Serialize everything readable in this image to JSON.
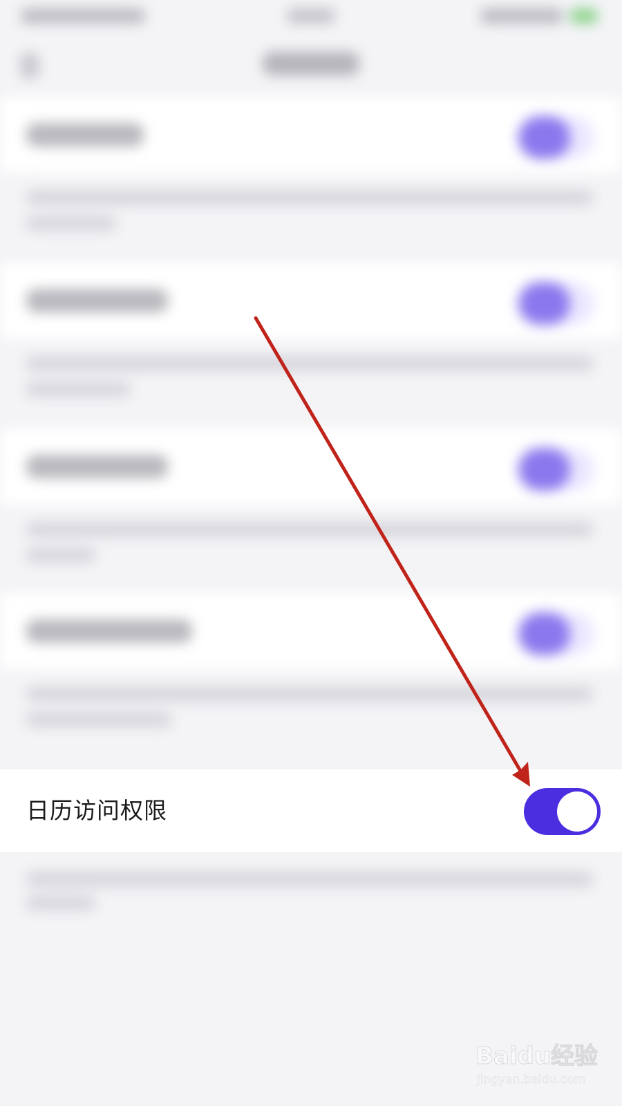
{
  "setting": {
    "label": "日历访问权限",
    "enabled": true
  },
  "colors": {
    "toggle_on": "#4a2ee0",
    "annotation_arrow": "#c0231a"
  },
  "watermark": {
    "logo": "Baidu经验",
    "url": "jingyan.baidu.com"
  }
}
